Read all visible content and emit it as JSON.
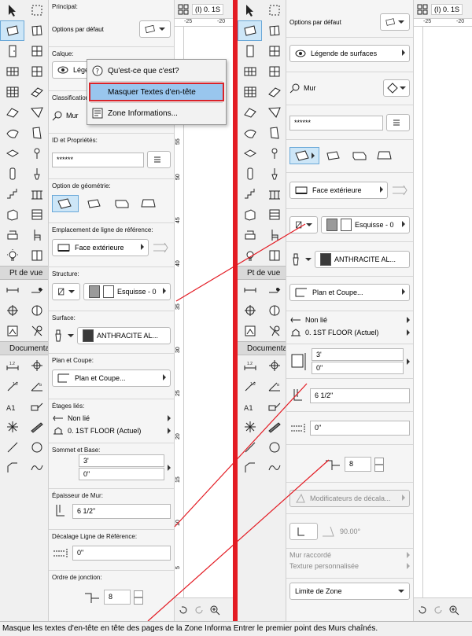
{
  "left": {
    "toolbox": {
      "sections": [
        "Pt de vue",
        "Documenta"
      ]
    },
    "infobox": {
      "principal_label": "Principal:",
      "options_defaut_label": "Options par défaut",
      "calque_label": "Calque:",
      "calque_value": "Légende de surfaces",
      "classification_label": "Classification",
      "classification_value": "Mur",
      "id_label": "ID et Propriétés:",
      "id_value": "******",
      "geometry_label": "Option de géométrie:",
      "ref_line_label": "Emplacement de ligne de référence:",
      "ref_line_value": "Face extérieure",
      "structure_label": "Structure:",
      "structure_value": "Esquisse - 0",
      "surface_label": "Surface:",
      "surface_value": "ANTHRACITE AL...",
      "plan_label": "Plan et Coupe:",
      "plan_value": "Plan et Coupe...",
      "etages_label": "Étages liés:",
      "etage_top": "Non lié",
      "etage_bottom": "0. 1ST FLOOR (Actuel)",
      "sommet_label": "Sommet et Base:",
      "sommet_top": "3'",
      "sommet_bottom": "0\"",
      "epaisseur_label": "Épaisseur de Mur:",
      "epaisseur_value": "6 1/2\"",
      "decalage_label": "Décalage Ligne de Référence:",
      "decalage_value": "0\"",
      "jonction_label": "Ordre de jonction:",
      "jonction_value": "8"
    },
    "canvas": {
      "tab_label": "(I) 0. 1S",
      "ruler_top": [
        "-25",
        "-20"
      ],
      "ruler_left": [
        "55",
        "50",
        "45",
        "40",
        "35",
        "30",
        "25",
        "20",
        "15",
        "10",
        "5"
      ]
    }
  },
  "right": {
    "infobox": {
      "options_defaut_label": "Options par défaut",
      "calque_value": "Légende de surfaces",
      "classification_value": "Mur",
      "id_value": "******",
      "ref_line_value": "Face extérieure",
      "structure_value": "Esquisse - 0",
      "surface_value": "ANTHRACITE AL...",
      "plan_value": "Plan et Coupe...",
      "etage_top": "Non lié",
      "etage_bottom": "0. 1ST FLOOR (Actuel)",
      "sommet_top": "3'",
      "sommet_bottom": "0\"",
      "epaisseur_value": "6 1/2\"",
      "decalage_value": "0\"",
      "jonction_value": "8",
      "modificateurs_value": "Modificateurs de décala...",
      "angle_value": "90.00°",
      "mur_raccorde_label": "Mur raccordé",
      "texture_label": "Texture personnalisée",
      "limite_value": "Limite de Zone"
    },
    "toolbox": {
      "sections": [
        "Pt de vue",
        "Documenta"
      ]
    },
    "canvas": {
      "tab_label": "(I) 0. 1S",
      "ruler_top": [
        "-25",
        "-20"
      ]
    }
  },
  "context_menu": {
    "items": [
      {
        "label": "Qu'est-ce que c'est?",
        "icon": "help-icon"
      },
      {
        "label": "Masquer Textes d'en-tête",
        "icon": "none",
        "highlighted": true
      },
      {
        "label": "Zone Informations...",
        "icon": "info-icon"
      }
    ]
  },
  "status_bar": {
    "text": "Masque les textes d'en-tête en tête des pages de la Zone Informa Entrer le premier point des Murs chaînés."
  },
  "colors": {
    "divider": "#e31b23",
    "highlight": "#99c6ee",
    "highlight_border": "#d9232a",
    "annotation_line": "#e31b23",
    "surface_swatch": "#3a3a3a",
    "structure_swatch": "#9a9a9a"
  }
}
